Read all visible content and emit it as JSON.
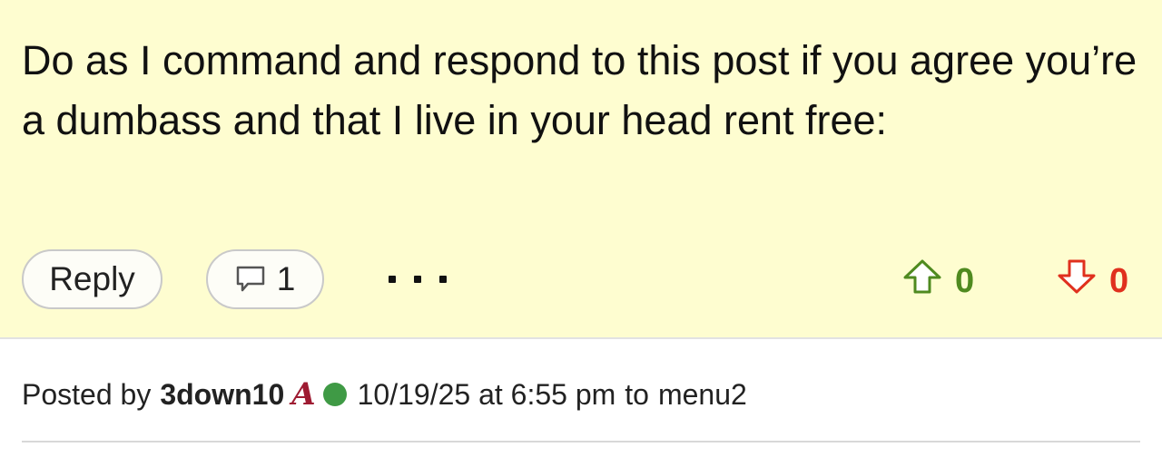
{
  "post": {
    "body": "Do as I command and respond to this post if you agree you’re a dumbass and that I live in your head rent free:"
  },
  "actions": {
    "reply_label": "Reply",
    "comment_count": "1",
    "upvotes": "0",
    "downvotes": "0"
  },
  "meta": {
    "posted_by_label": "Posted by",
    "username": "3down10",
    "team_logo_letter": "A",
    "timestamp": "10/19/25 at 6:55 pm",
    "to_label": "to",
    "reply_to_user": "menu2"
  },
  "colors": {
    "post_background": "#fefdd0",
    "upvote": "#4f8a1f",
    "downvote": "#e0301e",
    "team_logo": "#9e1b32",
    "online_indicator": "#3f9a45"
  }
}
